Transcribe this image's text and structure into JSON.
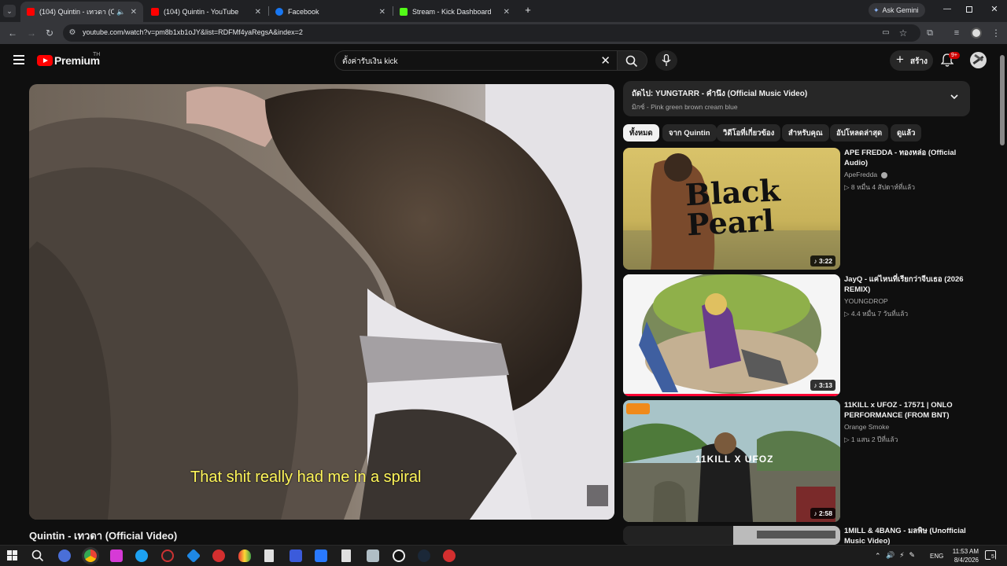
{
  "browser": {
    "tabs": [
      {
        "title": "(104) Quintin - เทวดา (Offici",
        "active": true
      },
      {
        "title": "(104) Quintin - YouTube",
        "active": false
      },
      {
        "title": "Facebook",
        "active": false
      },
      {
        "title": "Stream - Kick Dashboard",
        "active": false
      }
    ],
    "ask_gemini": "Ask Gemini",
    "url": "youtube.com/watch?v=pm8b1xb1oJY&list=RDFMf4yaRegsA&index=2"
  },
  "youtube": {
    "logo_text": "Premium",
    "region": "TH",
    "search_value": "ตั้งค่ารับเงิน kick",
    "create_label": "สร้าง",
    "notif_count": "9+"
  },
  "player": {
    "caption": "That shit really had me in a spiral",
    "video_title": "Quintin - เทวดา (Official Video)"
  },
  "playlist": {
    "next_label": "ถัดไป: YUNGTARR - คำนึง (Official Music Video)",
    "mix_label": "มิกซ์ - Pink green brown cream blue"
  },
  "chips": [
    "ทั้งหมด",
    "จาก Quintin",
    "วิดีโอที่เกี่ยวข้อง",
    "สำหรับคุณ",
    "อัปโหลดล่าสุด",
    "ดูแล้ว"
  ],
  "videos": [
    {
      "title": "APE FREDDA - ทองหล่อ (Official Audio)",
      "channel": "ApeFredda",
      "meta": "▷ 8 หมื่น  4 สัปดาห์ที่แล้ว",
      "duration": "♪ 3:22",
      "thumb_text": "Black Pearl"
    },
    {
      "title": "JayQ - แค่ไหนที่เรียกว่าจีบเธอ (2026 REMIX)",
      "channel": "YOUNGDROP",
      "meta": "▷ 4.4 หมื่น  7 วันที่แล้ว",
      "duration": "♪ 3:13"
    },
    {
      "title": "11KILL x UFOZ - 17571 | ONLO PERFORMANCE (FROM BNT)",
      "channel": "Orange Smoke",
      "meta": "▷ 1 แสน  2 ปีที่แล้ว",
      "duration": "♪ 2:58",
      "thumb_text": "11KILL X UFOZ"
    },
    {
      "title": "1MILL & 4BANG - มลพิษ (Unofficial Music Video)"
    }
  ],
  "taskbar": {
    "lang": "ENG",
    "time": "11:53 AM",
    "date": "8/4/2026",
    "notif": "5"
  }
}
